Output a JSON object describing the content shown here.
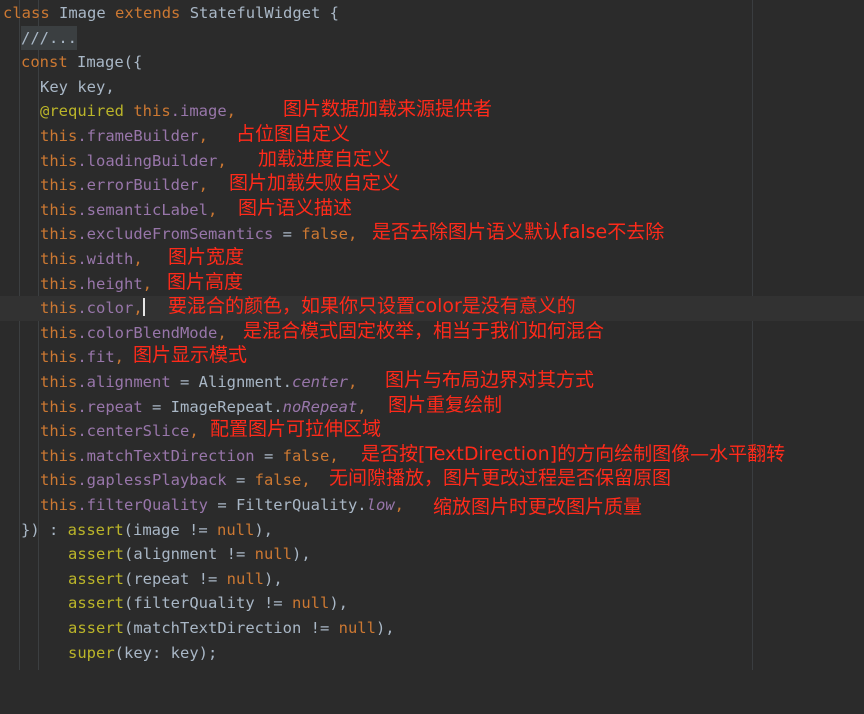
{
  "code": {
    "l1": {
      "kw1": "class",
      "name": "Image",
      "kw2": "extends",
      "base": "StatefulWidget {"
    },
    "l2": {
      "fold": "///..."
    },
    "l3": {
      "kw": "const",
      "rest": "Image({"
    },
    "l4": {
      "text": "Key key,"
    },
    "l5": {
      "ann": "@required",
      "kw": "this",
      "field": ".image",
      "rest": ","
    },
    "params": [
      {
        "kw": "this",
        "field": ".frameBuilder",
        "rest": ","
      },
      {
        "kw": "this",
        "field": ".loadingBuilder",
        "rest": ","
      },
      {
        "kw": "this",
        "field": ".errorBuilder",
        "rest": ","
      },
      {
        "kw": "this",
        "field": ".semanticLabel",
        "rest": ","
      },
      {
        "kw": "this",
        "field": ".excludeFromSemantics",
        "mid": " = ",
        "val": "false",
        "rest": ","
      },
      {
        "kw": "this",
        "field": ".width",
        "rest": ","
      },
      {
        "kw": "this",
        "field": ".height",
        "rest": ","
      },
      {
        "kw": "this",
        "field": ".color",
        "rest": ","
      },
      {
        "kw": "this",
        "field": ".colorBlendMode",
        "rest": ","
      },
      {
        "kw": "this",
        "field": ".fit",
        "rest": ","
      },
      {
        "kw": "this",
        "field": ".alignment",
        "mid": " = Alignment.",
        "cst": "center",
        "rest": ","
      },
      {
        "kw": "this",
        "field": ".repeat",
        "mid": " = ImageRepeat.",
        "cst": "noRepeat",
        "rest": ","
      },
      {
        "kw": "this",
        "field": ".centerSlice",
        "rest": ","
      },
      {
        "kw": "this",
        "field": ".matchTextDirection",
        "mid": " = ",
        "val": "false",
        "rest": ","
      },
      {
        "kw": "this",
        "field": ".gaplessPlayback",
        "mid": " = ",
        "val": "false",
        "rest": ","
      },
      {
        "kw": "this",
        "field": ".filterQuality",
        "mid": " = FilterQuality.",
        "cst": "low",
        "rest": ","
      }
    ],
    "close": {
      "pre": "}) : ",
      "kw": "assert",
      "rest1": "(image != ",
      "null": "null",
      "rest2": "),"
    },
    "asserts": [
      {
        "kw": "assert",
        "a": "(alignment != ",
        "null": "null",
        "b": "),"
      },
      {
        "kw": "assert",
        "a": "(repeat != ",
        "null": "null",
        "b": "),"
      },
      {
        "kw": "assert",
        "a": "(filterQuality != ",
        "null": "null",
        "b": "),"
      },
      {
        "kw": "assert",
        "a": "(matchTextDirection != ",
        "null": "null",
        "b": "),"
      }
    ],
    "super": {
      "kw": "super",
      "rest": "(key: key);"
    }
  },
  "notes": {
    "image": "图片数据加载来源提供者",
    "frameBuilder": "占位图自定义",
    "loadingBuilder": "加载进度自定义",
    "errorBuilder": "图片加载失败自定义",
    "semanticLabel": "图片语义描述",
    "excludeFromSemantics": "是否去除图片语义默认false不去除",
    "width": "图片宽度",
    "height": "图片高度",
    "color": "要混合的颜色，如果你只设置color是没有意义的",
    "colorBlendMode": "是混合模式固定枚举，相当于我们如何混合",
    "fit": "图片显示模式",
    "alignment": "图片与布局边界对其方式",
    "repeat": "图片重复绘制",
    "centerSlice": "配置图片可拉伸区域",
    "matchTextDirection": "是否按[TextDirection]的方向绘制图像—水平翻转",
    "gaplessPlayback": "无间隙播放，图片更改过程是否保留原图",
    "filterQuality": "缩放图片时更改图片质量"
  },
  "colors": {
    "background": "#2b2b2b",
    "keyword": "#cc7832",
    "field": "#9876aa",
    "annotation": "#bbb529",
    "text": "#a9b7c6",
    "note": "#ff2a1a"
  }
}
